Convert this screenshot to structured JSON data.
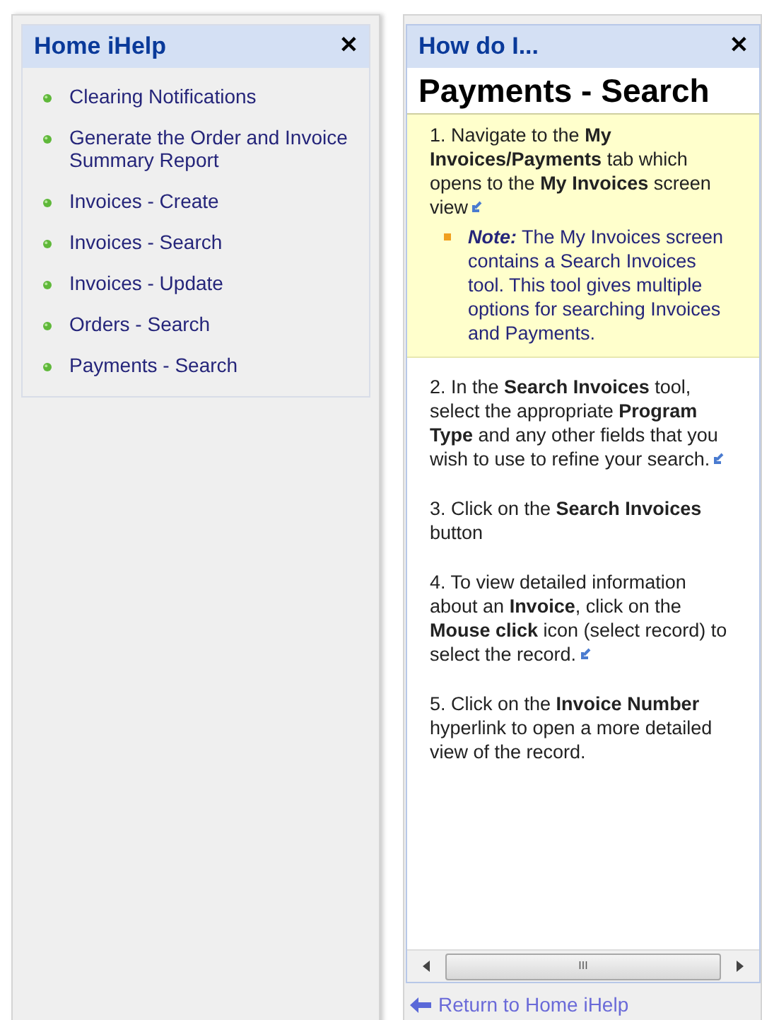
{
  "home_panel": {
    "title": "Home iHelp",
    "close": "✕",
    "items": [
      {
        "label": "Clearing Notifications"
      },
      {
        "label": "Generate the Order and Invoice Summary Report"
      },
      {
        "label": "Invoices - Create"
      },
      {
        "label": "Invoices - Search"
      },
      {
        "label": "Invoices - Update"
      },
      {
        "label": "Orders - Search"
      },
      {
        "label": "Payments - Search"
      }
    ]
  },
  "howto_panel": {
    "title": "How do I...",
    "close": "✕",
    "topic": "Payments - Search",
    "steps": [
      {
        "text": "1. Navigate to the **My Invoices/Payments** tab which opens to the **My Invoices** screen view",
        "highlighted": true,
        "link_icon": true,
        "note": {
          "label": "Note:",
          "text": "The My Invoices screen contains a Search Invoices tool. This tool gives multiple options for searching Invoices and Payments."
        }
      },
      {
        "text": "2. In the **Search Invoices** tool, select the appropriate **Program Type** and any other fields that you wish to use to refine your search.",
        "highlighted": false,
        "link_icon": true
      },
      {
        "text": "3. Click on the **Search Invoices** button",
        "highlighted": false,
        "link_icon": false
      },
      {
        "text": "4. To view detailed information about an **Invoice**, click on the **Mouse click** icon (select record) to select the record.",
        "highlighted": false,
        "link_icon": true
      },
      {
        "text": "5. Click on the **Invoice Number** hyperlink to open a more detailed view of the record.",
        "highlighted": false,
        "link_icon": false
      }
    ],
    "scrollbar_grip": "III",
    "return_link": "Return to Home iHelp"
  }
}
